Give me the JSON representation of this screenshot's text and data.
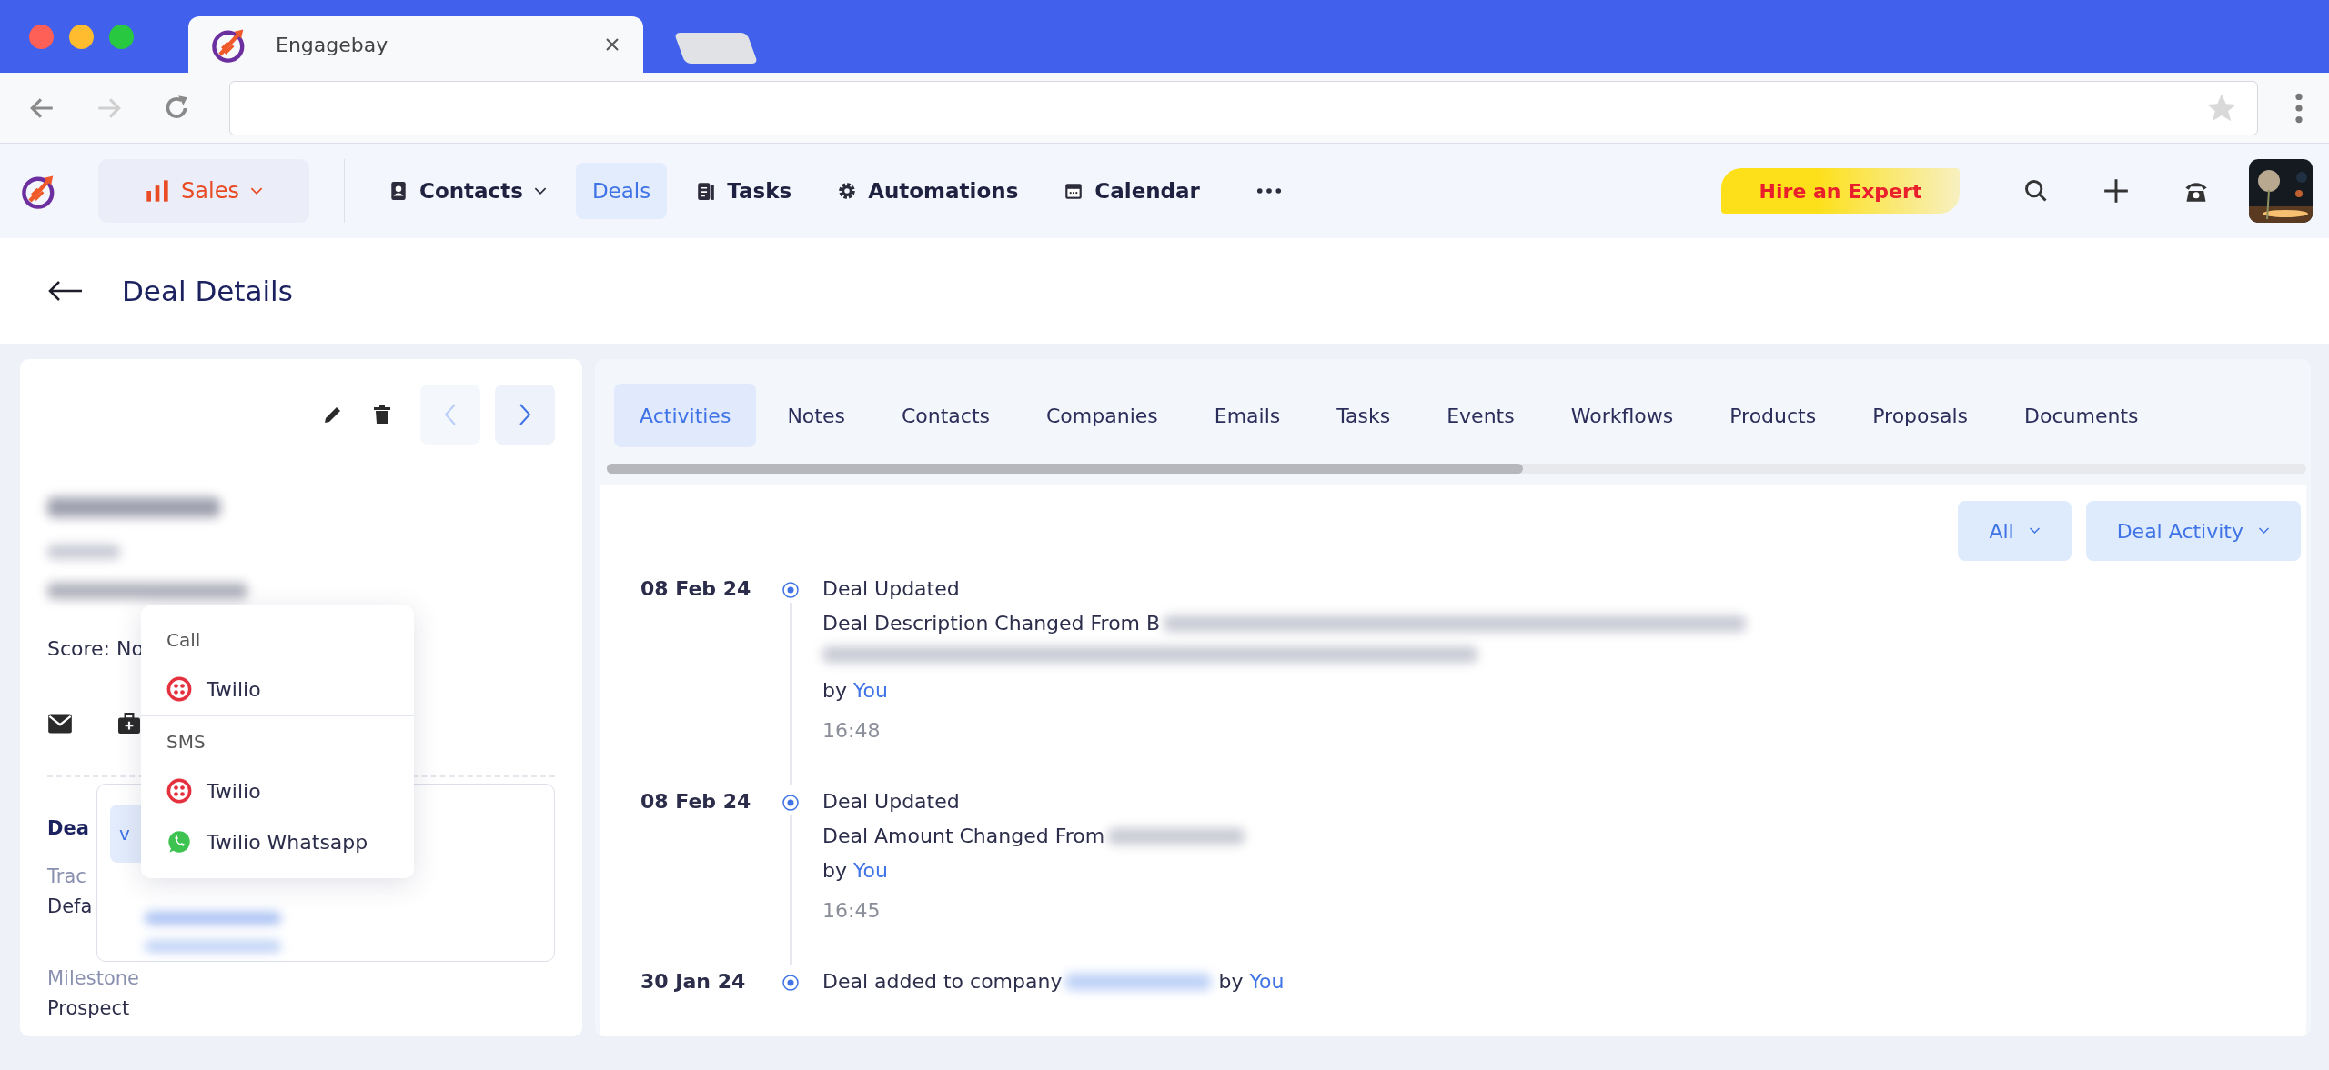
{
  "browser": {
    "tab_title": "Engagebay"
  },
  "nav": {
    "module": "Sales",
    "items": [
      {
        "label": "Contacts",
        "kind": "contacts",
        "dropdown": true,
        "selected": false
      },
      {
        "label": "Deals",
        "kind": "deals",
        "dropdown": false,
        "selected": true
      },
      {
        "label": "Tasks",
        "kind": "tasks",
        "dropdown": false,
        "selected": false
      },
      {
        "label": "Automations",
        "kind": "automations",
        "dropdown": false,
        "selected": false
      },
      {
        "label": "Calendar",
        "kind": "calendar",
        "dropdown": false,
        "selected": false
      }
    ],
    "cta": "Hire an Expert"
  },
  "page": {
    "title": "Deal Details"
  },
  "deal_card": {
    "score": "Score: No",
    "labels": [
      "Dea",
      "Trac",
      "Defa",
      "Milestone",
      "Prospect"
    ],
    "popover_button": "v"
  },
  "menu": {
    "groups": [
      {
        "heading": "Call",
        "items": [
          {
            "label": "Twilio",
            "kind": "twilio"
          }
        ]
      },
      {
        "heading": "SMS",
        "items": [
          {
            "label": "Twilio",
            "kind": "twilio"
          },
          {
            "label": "Twilio Whatsapp",
            "kind": "whatsapp"
          }
        ]
      }
    ]
  },
  "tabs": [
    {
      "label": "Activities",
      "selected": true
    },
    {
      "label": "Notes",
      "selected": false
    },
    {
      "label": "Contacts",
      "selected": false
    },
    {
      "label": "Companies",
      "selected": false
    },
    {
      "label": "Emails",
      "selected": false
    },
    {
      "label": "Tasks",
      "selected": false
    },
    {
      "label": "Events",
      "selected": false
    },
    {
      "label": "Workflows",
      "selected": false
    },
    {
      "label": "Products",
      "selected": false
    },
    {
      "label": "Proposals",
      "selected": false
    },
    {
      "label": "Documents",
      "selected": false
    }
  ],
  "filters": [
    "All",
    "Deal Activity"
  ],
  "timeline": [
    {
      "date": "08 Feb 24",
      "kind": "update",
      "title": "Deal Updated",
      "text": "Deal Description Changed From B",
      "redacted": true,
      "redacted_wrap": true,
      "by": "by",
      "author": "You",
      "time": "16:48"
    },
    {
      "date": "08 Feb 24",
      "kind": "update",
      "title": "Deal Updated",
      "text": "Deal Amount Changed From",
      "redacted": true,
      "redacted_wrap": false,
      "by": "by",
      "author": "You",
      "time": "16:45"
    },
    {
      "date": "30 Jan 24",
      "kind": "inline",
      "text": "Deal added to company",
      "redacted": true,
      "by": "by",
      "author": "You"
    }
  ]
}
